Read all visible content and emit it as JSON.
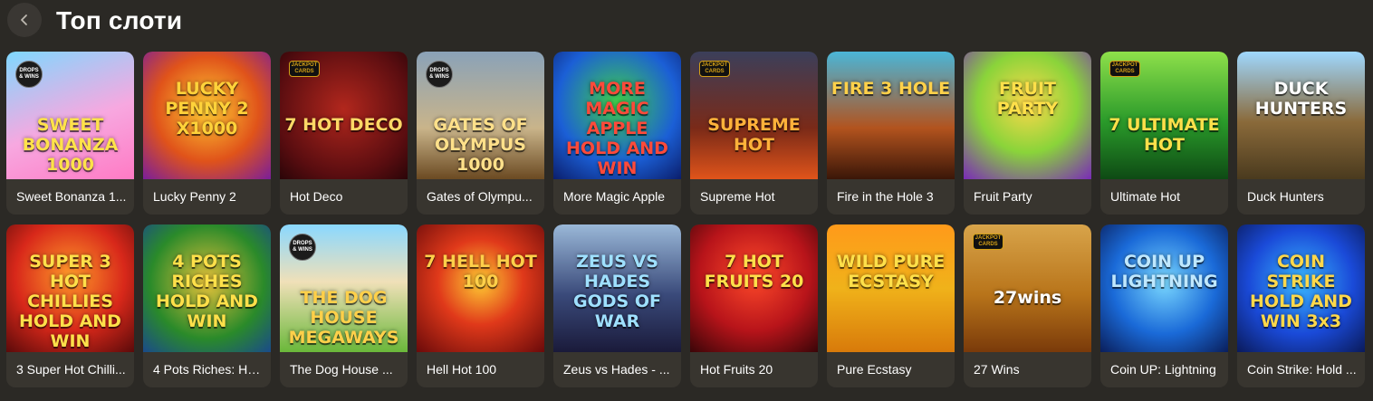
{
  "header": {
    "title": "Топ слоти",
    "back_icon": "chevron-left-icon"
  },
  "games": [
    {
      "name": "Sweet Bonanza 1...",
      "art": "SWEET BONANZA 1000",
      "art_color": "#ffe24a",
      "bg": "linear-gradient(160deg,#7fd8ff 0%,#f7a8e0 55%,#ff7ac4 100%)",
      "badge": "DROPS & WINS",
      "badge_type": "drops"
    },
    {
      "name": "Lucky Penny 2",
      "art": "LUCKY PENNY 2 X1000",
      "art_color": "#ffd23a",
      "bg": "radial-gradient(circle at 50% 45%,#ffcc33 0%,#e0531a 55%,#7a1e9a 100%)",
      "badge": "",
      "badge_type": ""
    },
    {
      "name": "Hot Deco",
      "art": "7 HOT DECO",
      "art_color": "#ffd866",
      "bg": "radial-gradient(circle at 50% 45%,#b2271d 0%,#5a0d10 70%,#2a0508 100%)",
      "badge": "JACKPOT CARDS",
      "badge_type": "jackpot"
    },
    {
      "name": "Gates of Olympu...",
      "art": "GATES OF OLYMPUS 1000",
      "art_color": "#ffe08a",
      "bg": "linear-gradient(180deg,#8aa2b8 0%,#c9b48a 60%,#6b4a22 100%)",
      "badge": "DROPS & WINS",
      "badge_type": "drops"
    },
    {
      "name": "More Magic Apple",
      "art": "MORE MAGIC APPLE HOLD AND WIN",
      "art_color": "#ff4a3a",
      "bg": "radial-gradient(circle at 50% 40%,#3fcf4a 0%,#1b5fd6 60%,#0b1e6b 100%)",
      "badge": "",
      "badge_type": ""
    },
    {
      "name": "Supreme Hot",
      "art": "SUPREME HOT",
      "art_color": "#ffb23a",
      "bg": "linear-gradient(180deg,#3b3f5a 0%,#7a2a18 60%,#e0541a 100%)",
      "badge": "JACKPOT CARDS",
      "badge_type": "jackpot"
    },
    {
      "name": "Fire in the Hole 3",
      "art": "FIRE 3 HOLE",
      "art_color": "#ffd14a",
      "bg": "linear-gradient(180deg,#4ab6d8 0%,#b2531e 60%,#3a1608 100%)",
      "badge": "",
      "badge_type": ""
    },
    {
      "name": "Fruit Party",
      "art": "FRUIT PARTY",
      "art_color": "#ffe04a",
      "bg": "radial-gradient(circle at 50% 40%,#ffd84a 0%,#8ad43a 50%,#7a2ab8 100%)",
      "badge": "",
      "badge_type": ""
    },
    {
      "name": "Ultimate Hot",
      "art": "7 ULTIMATE HOT",
      "art_color": "#ffe04a",
      "bg": "linear-gradient(180deg,#8ee04a 0%,#2a9a2a 55%,#0e4a14 100%)",
      "badge": "JACKPOT CARDS",
      "badge_type": "jackpot"
    },
    {
      "name": "Duck Hunters",
      "art": "DUCK HUNTERS",
      "art_color": "#ffffff",
      "bg": "linear-gradient(180deg,#9fd8ff 0%,#8a6a3a 55%,#4a3a1e 100%)",
      "badge": "",
      "badge_type": ""
    },
    {
      "name": "3 Super Hot Chilli...",
      "art": "SUPER 3 HOT CHILLIES HOLD AND WIN",
      "art_color": "#ffe04a",
      "bg": "radial-gradient(circle at 50% 40%,#ff9a2a 0%,#d8281a 55%,#5a0a0a 100%)",
      "badge": "",
      "badge_type": ""
    },
    {
      "name": "4 Pots Riches: Hol...",
      "art": "4 POTS RICHES HOLD AND WIN",
      "art_color": "#ffe04a",
      "bg": "radial-gradient(circle at 50% 45%,#e8c23a 0%,#2a8a2a 60%,#1a4a8a 100%)",
      "badge": "",
      "badge_type": ""
    },
    {
      "name": "The Dog House ...",
      "art": "THE DOG HOUSE MEGAWAYS",
      "art_color": "#ffd04a",
      "bg": "linear-gradient(180deg,#8ad8ff 0%,#f0e0b8 45%,#6ab83a 100%)",
      "badge": "DROPS & WINS",
      "badge_type": "drops"
    },
    {
      "name": "Hell Hot 100",
      "art": "7 HELL HOT 100",
      "art_color": "#ffd04a",
      "bg": "radial-gradient(circle at 50% 45%,#ffcc33 0%,#e0391a 45%,#6a0a0a 100%)",
      "badge": "",
      "badge_type": ""
    },
    {
      "name": "Zeus vs Hades - ...",
      "art": "ZEUS VS HADES GODS OF WAR",
      "art_color": "#9fe0ff",
      "bg": "linear-gradient(180deg,#9ab8d8 0%,#3a4a7a 55%,#1a1a3a 100%)",
      "badge": "",
      "badge_type": ""
    },
    {
      "name": "Hot Fruits 20",
      "art": "7 HOT FRUITS 20",
      "art_color": "#ffe04a",
      "bg": "radial-gradient(circle at 50% 40%,#ff4a2a 0%,#b8141a 55%,#3a0508 100%)",
      "badge": "",
      "badge_type": ""
    },
    {
      "name": "Pure Ecstasy",
      "art": "WILD PURE ECSTASY",
      "art_color": "#ffe04a",
      "bg": "linear-gradient(180deg,#ff9a1a 0%,#f0b21a 50%,#d87a0a 100%)",
      "badge": "",
      "badge_type": ""
    },
    {
      "name": "27 Wins",
      "art": "27wins",
      "art_color": "#ffffff",
      "bg": "linear-gradient(180deg,#d8a44a 0%,#b8741a 55%,#7a3a0a 100%)",
      "badge": "JACKPOT CARDS",
      "badge_type": "jackpot"
    },
    {
      "name": "Coin UP: Lightning",
      "art": "COIN UP LIGHTNING",
      "art_color": "#bfe8ff",
      "bg": "radial-gradient(circle at 50% 45%,#7ad8ff 0%,#1a6ad8 55%,#0a1e5a 100%)",
      "badge": "",
      "badge_type": ""
    },
    {
      "name": "Coin Strike: Hold ...",
      "art": "COIN STRIKE HOLD AND WIN 3x3",
      "art_color": "#ffd84a",
      "bg": "radial-gradient(circle at 50% 45%,#3ab8ff 0%,#1a4ad8 55%,#0a1a5a 100%)",
      "badge": "",
      "badge_type": ""
    }
  ]
}
